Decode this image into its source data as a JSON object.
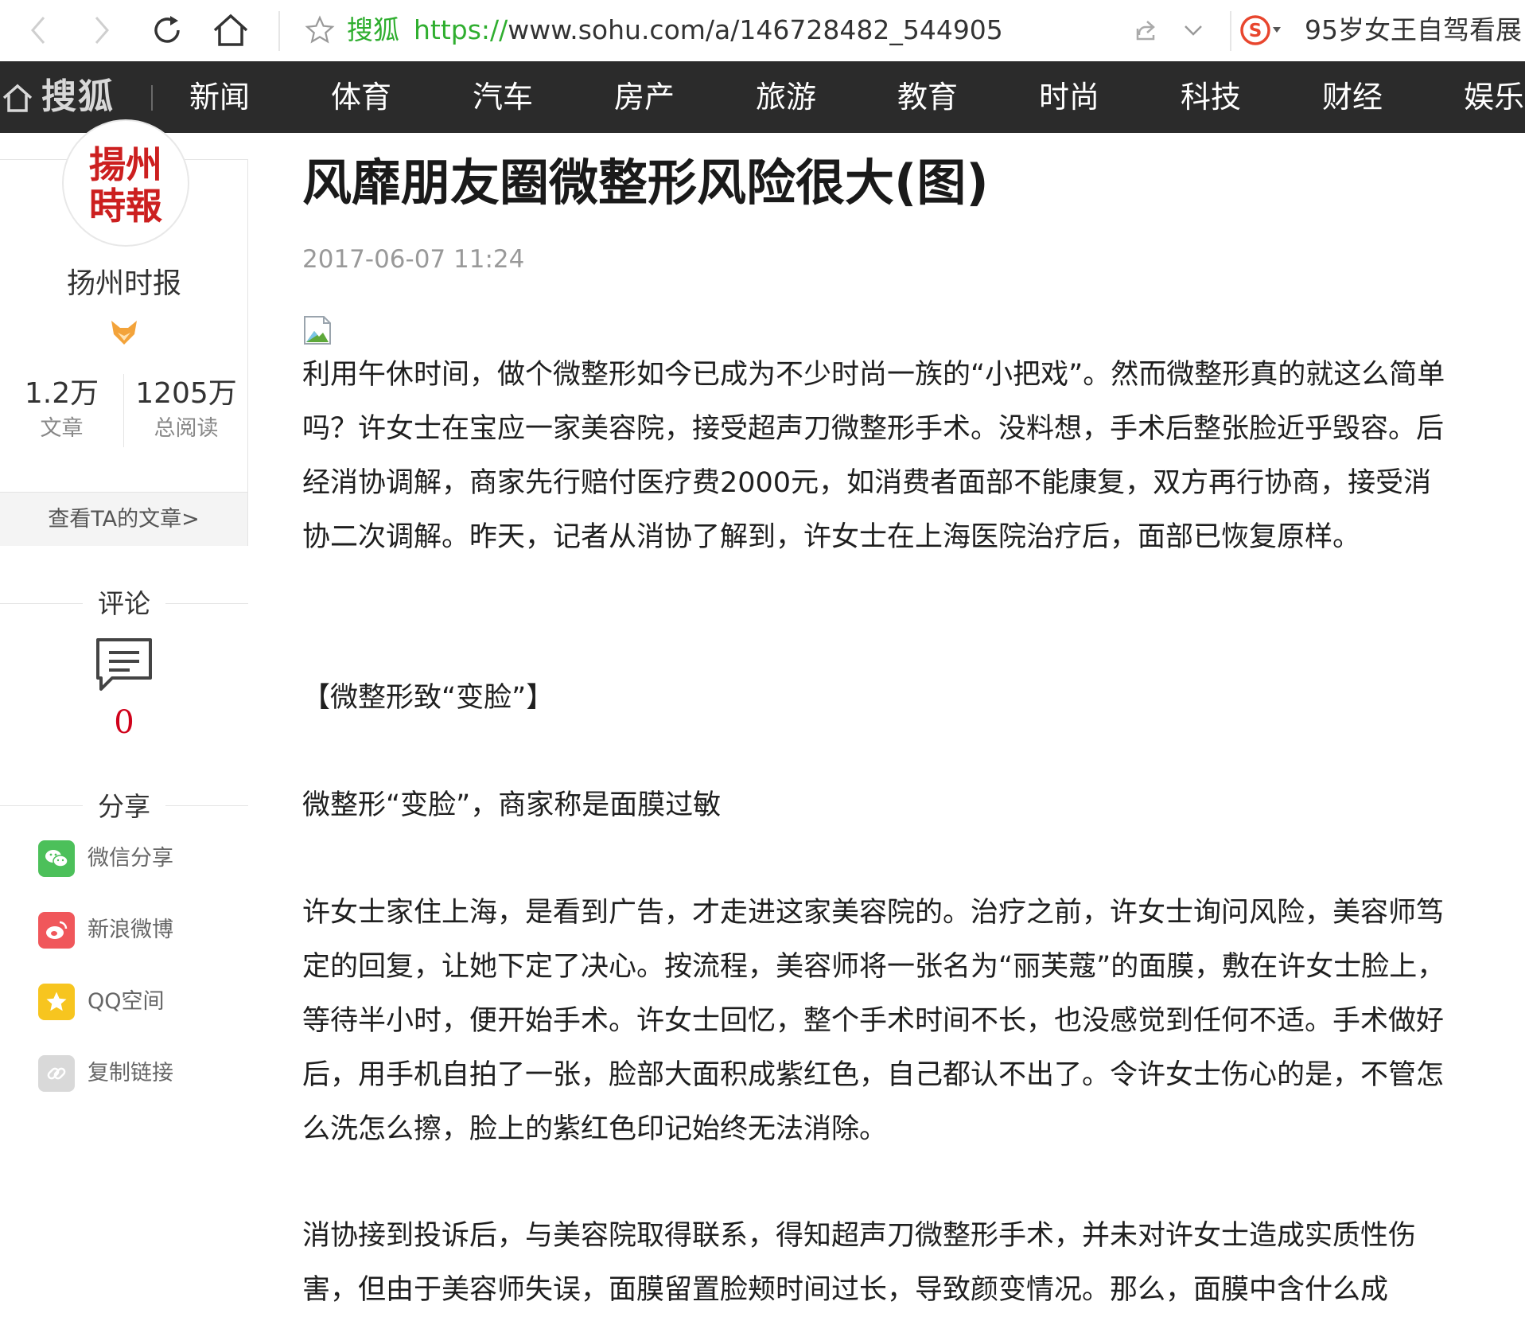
{
  "browser": {
    "site_name": "搜狐",
    "url_scheme": "https://",
    "url_rest": "www.sohu.com/a/146728482_544905",
    "hot_search": "95岁女王自驾看展"
  },
  "site_nav": {
    "logo_text": "搜狐",
    "items": [
      "新闻",
      "体育",
      "汽车",
      "房产",
      "旅游",
      "教育",
      "时尚",
      "科技",
      "财经",
      "娱乐"
    ]
  },
  "author": {
    "logo_text": "揚州時報",
    "name": "扬州时报",
    "articles_count": "1.2万",
    "articles_label": "文章",
    "reads_count": "1205万",
    "reads_label": "总阅读",
    "view_articles_link": "查看TA的文章>"
  },
  "comments": {
    "title": "评论",
    "count": "0"
  },
  "share": {
    "title": "分享",
    "items": [
      {
        "label": "微信分享",
        "icon": "wechat-icon",
        "color": "#4cc05a"
      },
      {
        "label": "新浪微博",
        "icon": "weibo-icon",
        "color": "#f0575b"
      },
      {
        "label": "QQ空间",
        "icon": "qzone-icon",
        "color": "#f7c51f"
      },
      {
        "label": "复制链接",
        "icon": "link-icon",
        "color": "#d9d9d9"
      }
    ]
  },
  "article": {
    "title": "风靡朋友圈微整形风险很大(图)",
    "date": "2017-06-07 11:24",
    "paragraphs": [
      "利用午休时间，做个微整形如今已成为不少时尚一族的“小把戏”。然而微整形真的就这么简单吗？许女士在宝应一家美容院，接受超声刀微整形手术。没料想，手术后整张脸近乎毁容。后经消协调解，商家先行赔付医疗费2000元，如消费者面部不能康复，双方再行协商，接受消协二次调解。昨天，记者从消协了解到，许女士在上海医院治疗后，面部已恢复原样。",
      "【微整形致“变脸”】",
      "微整形“变脸”，商家称是面膜过敏",
      "许女士家住上海，是看到广告，才走进这家美容院的。治疗之前，许女士询问风险，美容师笃定的回复，让她下定了决心。按流程，美容师将一张名为“丽芙蔻”的面膜，敷在许女士脸上，等待半小时，便开始手术。许女士回忆，整个手术时间不长，也没感觉到任何不适。手术做好后，用手机自拍了一张，脸部大面积成紫红色，自己都认不出了。令许女士伤心的是，不管怎么洗怎么擦，脸上的紫红色印记始终无法消除。",
      "消协接到投诉后，与美容院取得联系，得知超声刀微整形手术，并未对许女士造成实质性伤害，但由于美容师失误，面膜留置脸颊时间过长，导致颜变情况。那么，面膜中含什么成"
    ]
  }
}
